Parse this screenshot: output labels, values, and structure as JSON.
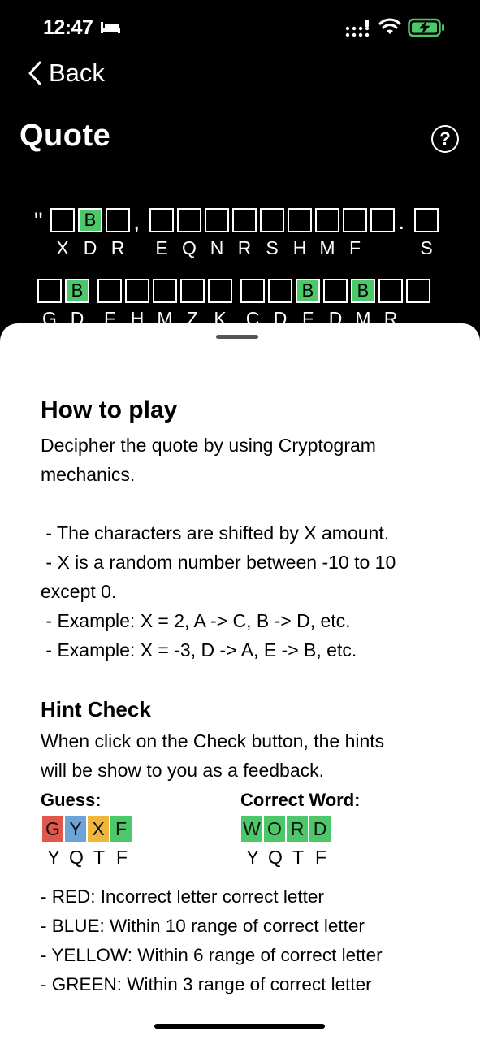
{
  "status": {
    "time": "12:47"
  },
  "nav": {
    "back_label": "Back",
    "title": "Quote",
    "help_label": "?"
  },
  "puzzle": {
    "open_quote": "\"",
    "row1": [
      {
        "cells": [
          "",
          "B",
          ""
        ],
        "green": [
          false,
          true,
          false
        ],
        "cipher": [
          "X",
          "D",
          "R"
        ],
        "after": ","
      },
      {
        "cells": [
          "",
          "",
          "",
          "",
          "",
          "",
          "",
          "",
          ""
        ],
        "green": [
          false,
          false,
          false,
          false,
          false,
          false,
          false,
          false,
          false
        ],
        "cipher": [
          "E",
          "Q",
          "N",
          "R",
          "S",
          "H",
          "M",
          "F",
          ""
        ],
        "after": "."
      },
      {
        "cells": [
          ""
        ],
        "green": [
          false
        ],
        "cipher": [
          "S"
        ],
        "after": ""
      }
    ],
    "row2": [
      {
        "cells": [
          "",
          "B"
        ],
        "green": [
          false,
          true
        ],
        "cipher": [
          "G",
          "D"
        ]
      },
      {
        "cells": [
          "",
          "",
          "",
          "",
          ""
        ],
        "green": [
          false,
          false,
          false,
          false,
          false
        ],
        "cipher": [
          "F",
          "H",
          "M",
          "Z",
          "K"
        ]
      },
      {
        "cells": [
          "",
          "",
          "B",
          "",
          "B",
          "",
          ""
        ],
        "green": [
          false,
          false,
          true,
          false,
          true,
          false,
          false
        ],
        "cipher": [
          "C",
          "D",
          "F",
          "D",
          "M",
          "R",
          ""
        ]
      }
    ]
  },
  "howto": {
    "title": "How to play",
    "intro_line1": "Decipher the quote by using Cryptogram",
    "intro_line2": "mechanics.",
    "rule1": " - The characters are shifted by X amount.",
    "rule2a": " - X is a random number between -10 to 10",
    "rule2b": "except 0.",
    "rule3": " - Example: X = 2, A -> C, B -> D, etc.",
    "rule4": " - Example: X = -3, D -> A, E -> B, etc."
  },
  "hint": {
    "title": "Hint Check",
    "desc_line1": "When click on the Check button, the hints",
    "desc_line2": "will be show to you as a feedback.",
    "guess_label": "Guess:",
    "correct_label": "Correct Word:",
    "guess_tiles": [
      {
        "letter": "G",
        "color": "red"
      },
      {
        "letter": "Y",
        "color": "blue"
      },
      {
        "letter": "X",
        "color": "yellow"
      },
      {
        "letter": "F",
        "color": "green"
      }
    ],
    "guess_cipher": [
      "Y",
      "Q",
      "T",
      "F"
    ],
    "correct_tiles": [
      {
        "letter": "W",
        "color": "green"
      },
      {
        "letter": "O",
        "color": "green"
      },
      {
        "letter": "R",
        "color": "green"
      },
      {
        "letter": "D",
        "color": "green"
      }
    ],
    "correct_cipher": [
      "Y",
      "Q",
      "T",
      "F"
    ],
    "legend1": "- RED: Incorrect letter correct letter",
    "legend2": "- BLUE: Within 10 range of correct letter",
    "legend3": "- YELLOW: Within 6 range of correct letter",
    "legend4": "- GREEN: Within 3 range of correct letter"
  },
  "colors": {
    "red": "#e0574c",
    "blue": "#6ea3d8",
    "yellow": "#f0b53b",
    "green": "#4cc86a"
  }
}
